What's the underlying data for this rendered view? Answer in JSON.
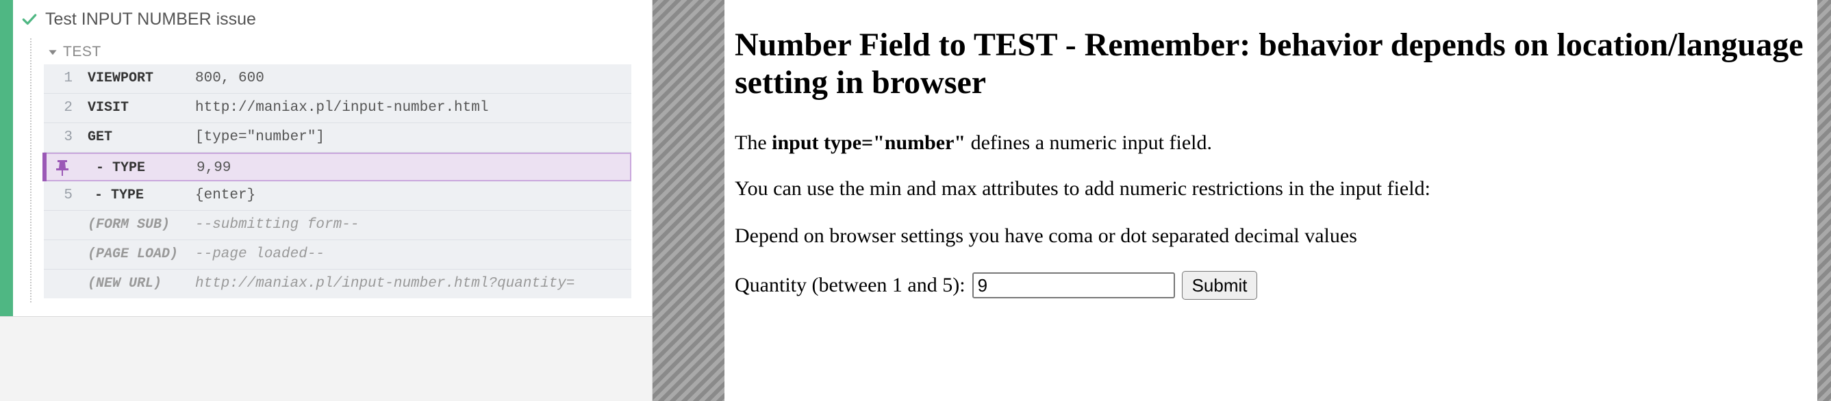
{
  "reporter": {
    "test_title": "Test INPUT NUMBER issue",
    "hook_title": "TEST",
    "commands": [
      {
        "num": "1",
        "name": "VIEWPORT",
        "message": "800, 600"
      },
      {
        "num": "2",
        "name": "VISIT",
        "message": "http://maniax.pl/input-number.html"
      },
      {
        "num": "3",
        "name": "GET",
        "message": "[type=\"number\"]"
      },
      {
        "num": "",
        "name": "- TYPE",
        "message": "9,99",
        "pinned": true
      },
      {
        "num": "5",
        "name": "- TYPE",
        "message": "{enter}"
      },
      {
        "num": "",
        "name": "(FORM SUB)",
        "message": "--submitting form--"
      },
      {
        "num": "",
        "name": "(PAGE LOAD)",
        "message": "--page loaded--"
      },
      {
        "num": "",
        "name": "(NEW URL)",
        "message": "http://maniax.pl/input-number.html?quantity="
      }
    ],
    "colors": {
      "passed": "#4fb783",
      "pinned": "#9b59b6"
    },
    "icons": {
      "status": "check-icon",
      "hook": "caret-down-icon",
      "pin": "pin-icon"
    }
  },
  "aut": {
    "heading": "Number Field to TEST - Remember: behavior depends on location/language setting in browser",
    "para1": {
      "before": "The ",
      "bold": "input type=\"number\"",
      "after": " defines a numeric input field."
    },
    "para2": "You can use the min and max attributes to add numeric restrictions in the input field:",
    "para3": "Depend on browser settings you have coma or dot separated decimal values",
    "form": {
      "label": "Quantity (between 1 and 5):",
      "input_value": "9",
      "submit_label": "Submit"
    }
  }
}
